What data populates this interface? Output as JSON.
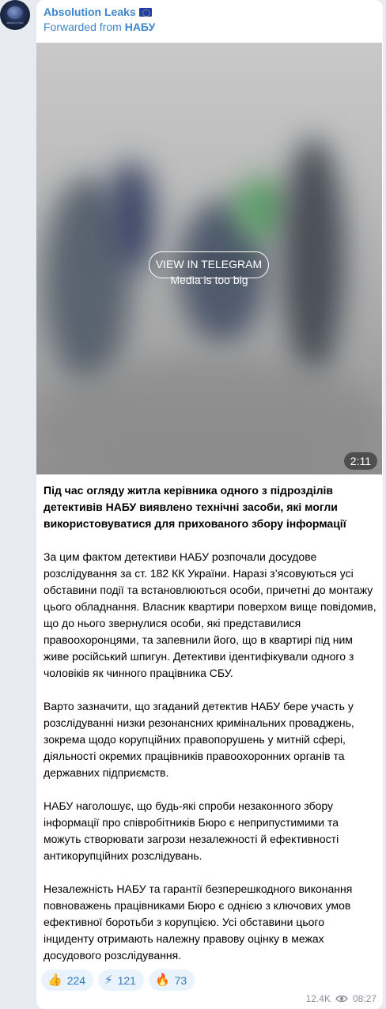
{
  "post": {
    "channel_name": "Absolution Leaks",
    "channel_flag": "eu-flag-icon",
    "forwarded_prefix": "Forwarded from ",
    "forwarded_source": "НАБУ",
    "avatar_caption": "ABSOLUTION"
  },
  "media": {
    "message": "Media is too big",
    "button_label": "VIEW IN TELEGRAM",
    "duration": "2:11"
  },
  "text": {
    "headline": "Під час огляду житла керівника одного з підрозділів детективів НАБУ виявлено технічні засоби, які могли використовуватися для прихованого збору інформації",
    "p1": "За цим фактом детективи НАБУ розпочали досудове розслідування за ст. 182 КК України. Наразі з’ясовуються усі обставини події та встановлюються особи, причетні до монтажу цього обладнання. Власник квартири поверхом вище повідомив, що до нього звернулися особи, які представилися правоохоронцями, та запевнили його, що в квартирі під ним живе російський шпигун. Детективи ідентифікували одного з чоловіків як чинного працівника СБУ.",
    "p2": "Варто зазначити, що згаданий детектив НАБУ бере участь у розслідуванні низки резонансних кримінальних проваджень, зокрема щодо корупційних правопорушень у митній сфері, діяльності окремих працівників правоохоронних органів та державних підприємств.",
    "p3": "НАБУ наголошує, що будь-які спроби незаконного збору інформації про співробітників Бюро є неприпустимими та можуть створювати загрози незалежності й ефективності антикорупційних розслідувань.",
    "p4": "Незалежність НАБУ та гарантії безперешкодного виконання повноважень працівниками Бюро є однією з ключових умов ефективної боротьби з корупцією. Усі обставини цього інциденту отримають належну правову оцінку в межах досудового розслідування."
  },
  "reactions": [
    {
      "icon": "👍",
      "icon_name": "thumbs-up-icon",
      "count": "224"
    },
    {
      "icon": "⚡",
      "icon_name": "lightning-icon",
      "count": "121"
    },
    {
      "icon": "🔥",
      "icon_name": "fire-icon",
      "count": "73"
    }
  ],
  "meta": {
    "views": "12.4K",
    "views_icon": "eye-icon",
    "time": "08:27"
  },
  "colors": {
    "accent": "#3d86cc",
    "background": "#e7ebf0",
    "reaction_bg": "#eaf3fb"
  }
}
